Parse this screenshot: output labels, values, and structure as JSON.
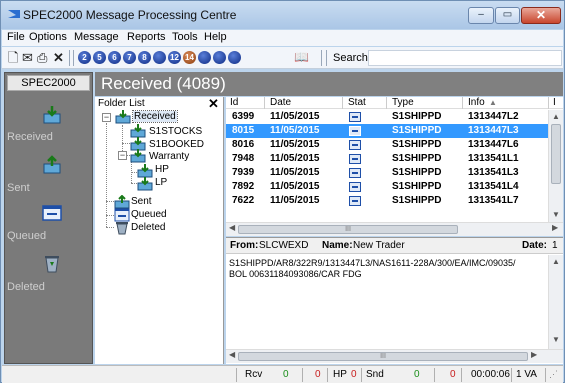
{
  "window": {
    "title": "SPEC2000 Message Processing Centre",
    "close_label": "✕",
    "max_label": "▭",
    "min_label": "–"
  },
  "menu": [
    "File",
    "Options",
    "Message",
    "Reports",
    "Tools",
    "Help"
  ],
  "toolbar": {
    "numbered_buttons": [
      "2",
      "5",
      "6",
      "7",
      "8",
      "",
      "12",
      "14",
      "",
      "",
      ""
    ],
    "search_label": "Search:",
    "search_value": ""
  },
  "sidebar": {
    "header": "SPEC2000",
    "items": [
      {
        "label": "Received",
        "icon": "received-tray-icon"
      },
      {
        "label": "Sent",
        "icon": "sent-tray-icon"
      },
      {
        "label": "Queued",
        "icon": "queued-window-icon"
      },
      {
        "label": "Deleted",
        "icon": "recycle-bin-icon"
      }
    ]
  },
  "content": {
    "title": "Received (4089)"
  },
  "folders": {
    "header": "Folder List",
    "close": "✕",
    "tree": {
      "received": "Received",
      "s1stocks": "S1STOCKS",
      "s1booked": "S1BOOKED",
      "warranty": "Warranty",
      "hp": "HP",
      "lp": "LP",
      "sent": "Sent",
      "queued": "Queued",
      "deleted": "Deleted"
    }
  },
  "list": {
    "columns": [
      "Id",
      "Date",
      "Stat",
      "Type",
      "Info",
      "I"
    ],
    "sort_indicator": "▲",
    "rows": [
      {
        "id": "6399",
        "date": "11/05/2015",
        "type": "S1SHIPPD",
        "info": "1313447L2"
      },
      {
        "id": "8015",
        "date": "11/05/2015",
        "type": "S1SHIPPD",
        "info": "1313447L3"
      },
      {
        "id": "8016",
        "date": "11/05/2015",
        "type": "S1SHIPPD",
        "info": "1313447L6"
      },
      {
        "id": "7948",
        "date": "11/05/2015",
        "type": "S1SHIPPD",
        "info": "1313541L1"
      },
      {
        "id": "7939",
        "date": "11/05/2015",
        "type": "S1SHIPPD",
        "info": "1313541L3"
      },
      {
        "id": "7892",
        "date": "11/05/2015",
        "type": "S1SHIPPD",
        "info": "1313541L4"
      },
      {
        "id": "7622",
        "date": "11/05/2015",
        "type": "S1SHIPPD",
        "info": "1313541L7"
      }
    ],
    "selected_index": 1,
    "hscroll_grip": "III"
  },
  "detail": {
    "from_label": "From:",
    "from_value": "SLCWEXD",
    "name_label": "Name:",
    "name_value": "New Trader",
    "date_label": "Date:",
    "date_value": "1",
    "lines": [
      "S1SHIPPD/AR8/322R9/1313447L3/NAS1611-228A/300/EA/IMC/09035/",
      "BOL 00631184093086/CAR FDG"
    ],
    "hscroll_grip": "III"
  },
  "status": {
    "rcv_label": "Rcv",
    "rcv_ok": "0",
    "rcv_err": "0",
    "hp_label": "HP",
    "hp_value": "0",
    "snd_label": "Snd",
    "snd_ok": "0",
    "snd_err": "0",
    "time": "00:00:06",
    "mode": "1 VA"
  },
  "colors": {
    "selection": "#3399ff",
    "title_bar": "#aac6e6",
    "sidebar": "#7a7a7a",
    "close_button": "#c9462e"
  }
}
